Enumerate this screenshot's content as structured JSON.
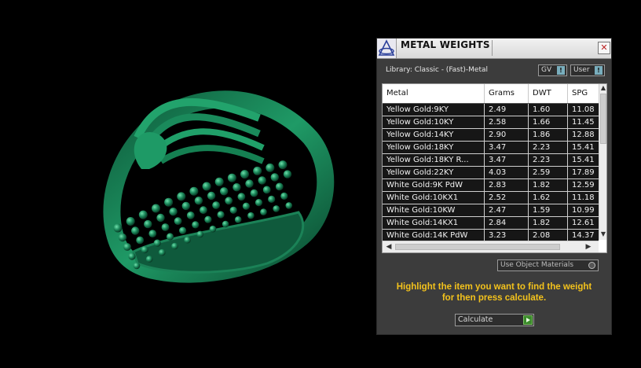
{
  "panel": {
    "title": "METAL WEIGHTS",
    "close_glyph": "✕",
    "library_label": "Library: Classic - (Fast)-Metal",
    "gv_label": "GV",
    "user_label": "User",
    "toggle_indicator": "!",
    "columns": [
      "Metal",
      "Grams",
      "DWT",
      "SPG"
    ],
    "rows": [
      [
        "Yellow Gold:9KY",
        "2.49",
        "1.60",
        "11.08"
      ],
      [
        "Yellow Gold:10KY",
        "2.58",
        "1.66",
        "11.45"
      ],
      [
        "Yellow Gold:14KY",
        "2.90",
        "1.86",
        "12.88"
      ],
      [
        "Yellow Gold:18KY",
        "3.47",
        "2.23",
        "15.41"
      ],
      [
        "Yellow Gold:18KY R...",
        "3.47",
        "2.23",
        "15.41"
      ],
      [
        "Yellow Gold:22KY",
        "4.03",
        "2.59",
        "17.89"
      ],
      [
        "White Gold:9K PdW",
        "2.83",
        "1.82",
        "12.59"
      ],
      [
        "White Gold:10KX1",
        "2.52",
        "1.62",
        "11.18"
      ],
      [
        "White Gold:10KW",
        "2.47",
        "1.59",
        "10.99"
      ],
      [
        "White Gold:14KX1",
        "2.84",
        "1.82",
        "12.61"
      ],
      [
        "White Gold:14K PdW",
        "3.23",
        "2.08",
        "14.37"
      ]
    ],
    "use_materials_label": "Use Object Materials",
    "hint_line1": "Highlight the item you want to find the weight",
    "hint_line2": "for then press calculate.",
    "calculate_label": "Calculate"
  },
  "colors": {
    "ring": "#1d8a5e",
    "panel_bg": "#3c3c3c",
    "hint_text": "#f3c21c",
    "row_bg": "#161616"
  },
  "icons": [
    "app-logo-icon",
    "close-icon",
    "scroll-up-icon",
    "scroll-down-icon",
    "scroll-left-icon",
    "scroll-right-icon",
    "go-arrow-icon"
  ]
}
